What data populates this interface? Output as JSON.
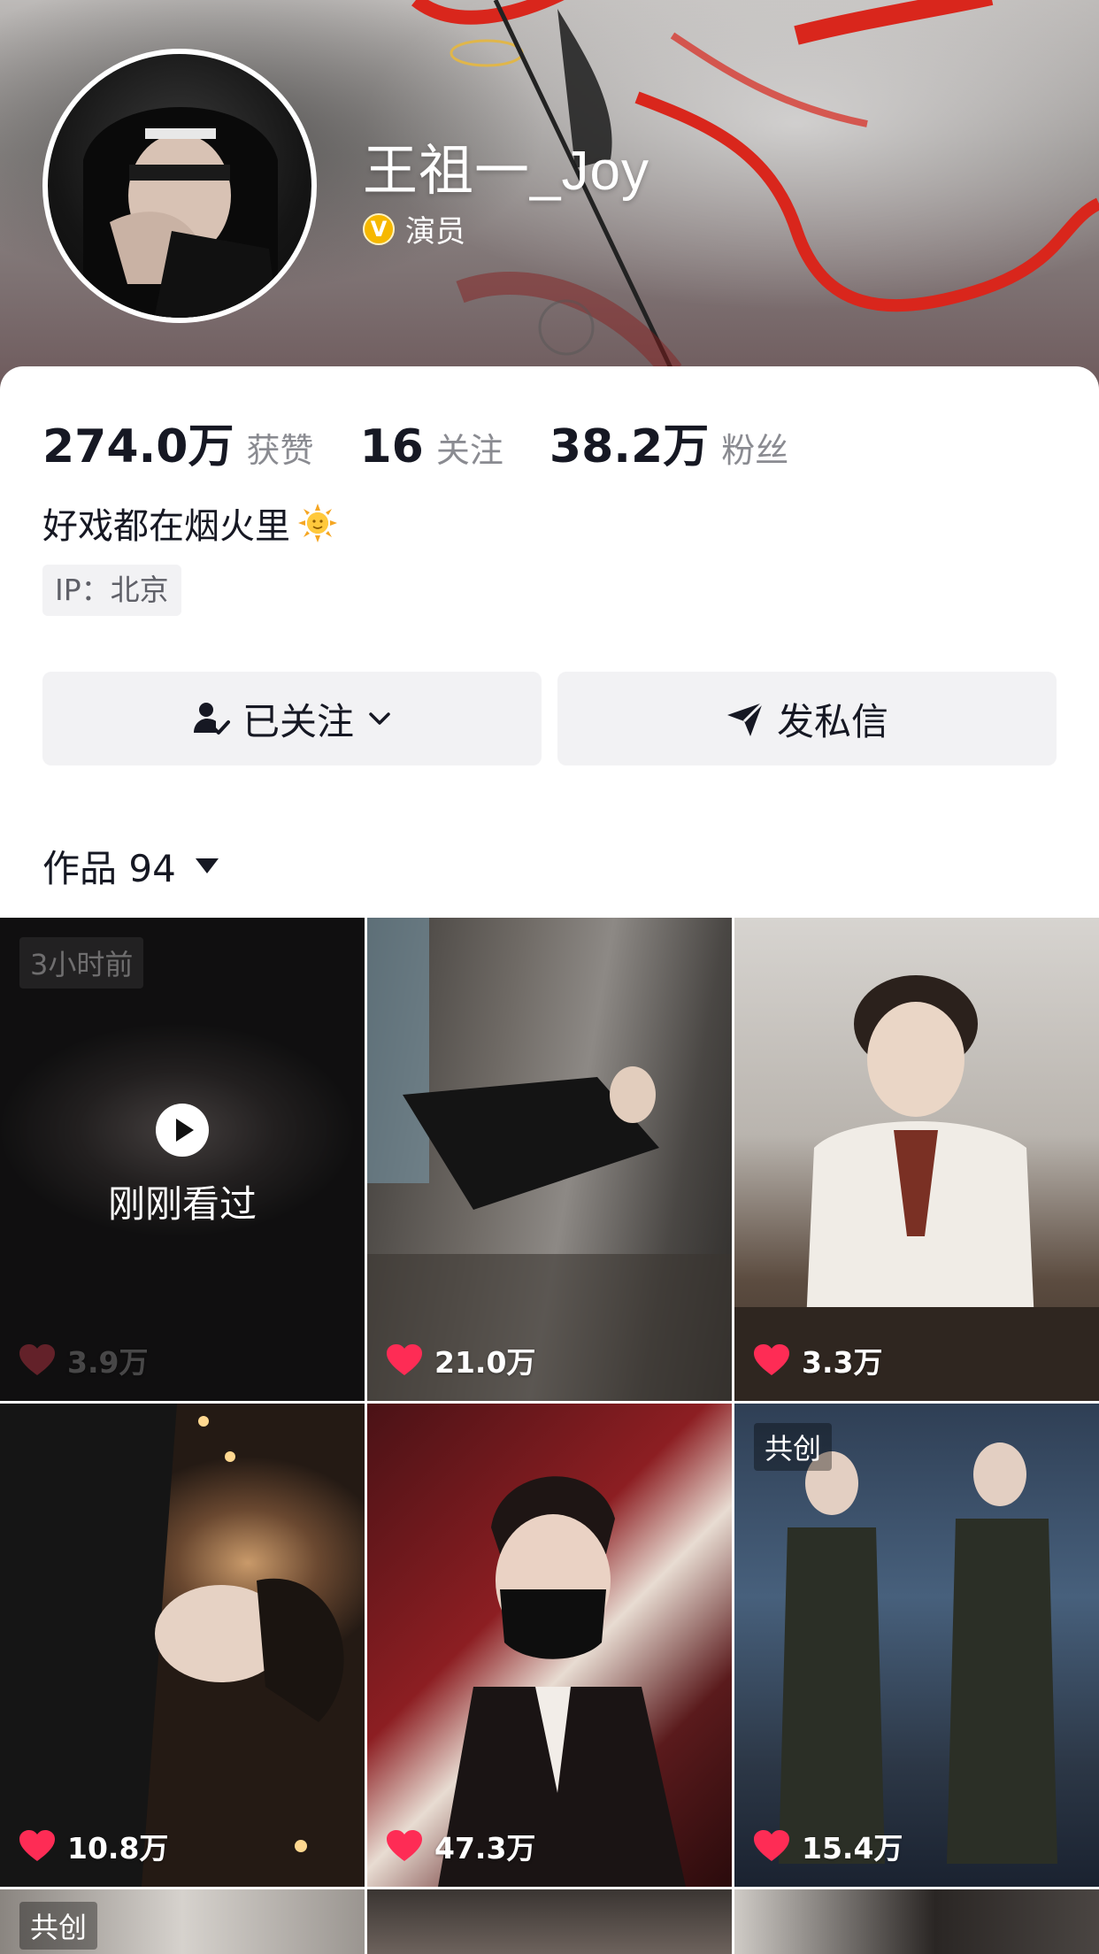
{
  "profile": {
    "nickname": "王祖一_Joy",
    "verify_icon": "V",
    "verify_label": "演员",
    "stats": [
      {
        "value": "274.0万",
        "label": "获赞"
      },
      {
        "value": "16",
        "label": "关注"
      },
      {
        "value": "38.2万",
        "label": "粉丝"
      }
    ],
    "bio": "好戏都在烟火里",
    "ip": "IP：北京"
  },
  "actions": {
    "follow_label": "已关注",
    "message_label": "发私信"
  },
  "tab": {
    "label": "作品 94"
  },
  "works": [
    {
      "likes": "3.9万",
      "time_badge": "3小时前",
      "overlay_text": "刚刚看过"
    },
    {
      "likes": "21.0万"
    },
    {
      "likes": "3.3万"
    },
    {
      "likes": "10.8万"
    },
    {
      "likes": "47.3万"
    },
    {
      "likes": "15.4万",
      "tag": "共创"
    },
    {
      "tag": "共创"
    }
  ],
  "colors": {
    "heart": "#fe2c55",
    "verify_badge": "#f6b800"
  }
}
